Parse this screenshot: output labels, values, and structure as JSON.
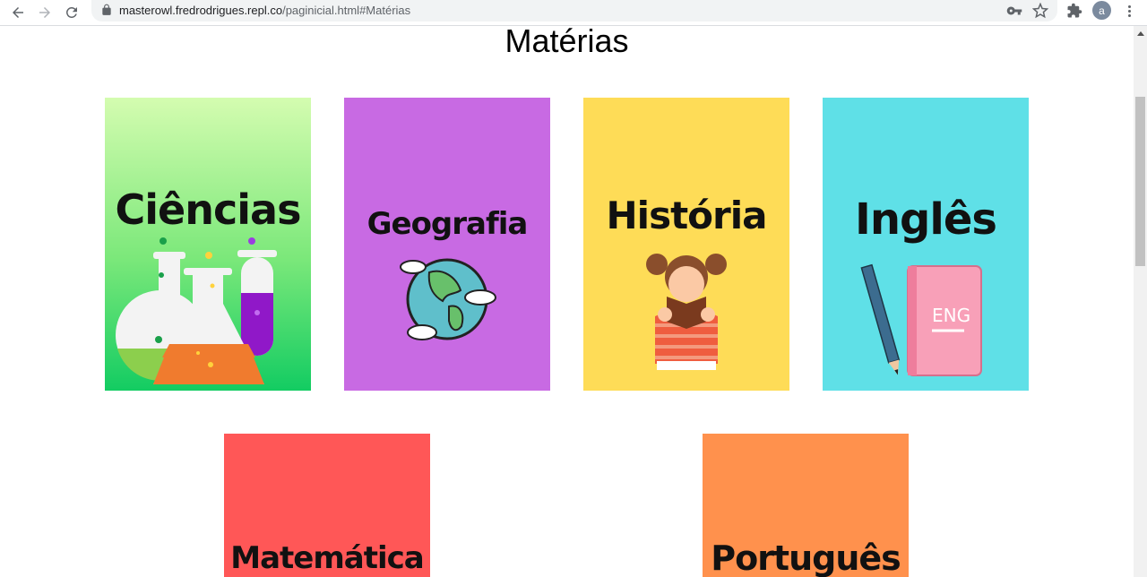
{
  "browser": {
    "url_host": "masterowl.fredrodrigues.repl.co",
    "url_path": "/paginicial.html#Matérias",
    "profile_initial": "a"
  },
  "page": {
    "title": "Matérias"
  },
  "cards": [
    {
      "label": "Ciências",
      "color": "#4ee07c"
    },
    {
      "label": "Geografia",
      "color": "#c86ae3"
    },
    {
      "label": "História",
      "color": "#fedc57"
    },
    {
      "label": "Inglês",
      "color": "#5fe0e7"
    },
    {
      "label": "Matemática",
      "color": "#ff5757"
    },
    {
      "label": "Português",
      "color": "#ff914d"
    }
  ],
  "icons": {
    "back": "arrow-left-icon",
    "forward": "arrow-right-icon",
    "reload": "reload-icon",
    "lock": "lock-icon",
    "password": "key-icon",
    "bookmark": "star-icon",
    "extensions": "puzzle-icon",
    "menu": "kebab-menu-icon"
  },
  "card_text": {
    "ingles_book": "ENG"
  }
}
